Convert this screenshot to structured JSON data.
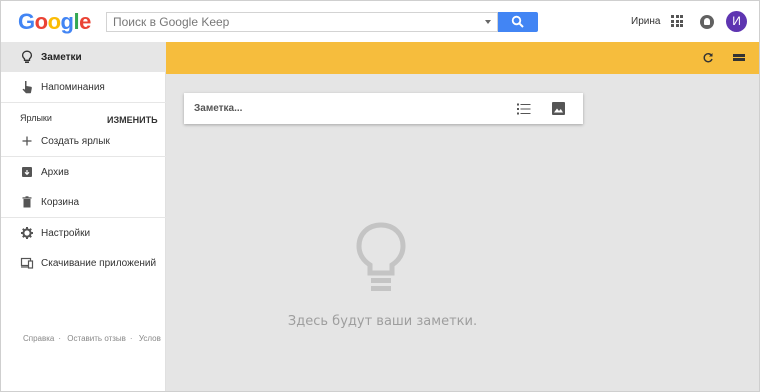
{
  "header": {
    "logo_letters": [
      {
        "ch": "G",
        "color": "#4285f4"
      },
      {
        "ch": "o",
        "color": "#ea4335"
      },
      {
        "ch": "o",
        "color": "#fbbc05"
      },
      {
        "ch": "g",
        "color": "#4285f4"
      },
      {
        "ch": "l",
        "color": "#34a853"
      },
      {
        "ch": "e",
        "color": "#ea4335"
      }
    ],
    "search_placeholder": "Поиск в Google Keep",
    "user_name": "Ирина",
    "avatar_letter": "И",
    "avatar_color": "#5e35b1",
    "search_button_color": "#4285f4"
  },
  "sidebar": {
    "items": [
      {
        "label": "Заметки",
        "icon": "lightbulb-icon",
        "active": true
      },
      {
        "label": "Напоминания",
        "icon": "reminder-hand-icon",
        "active": false
      },
      {
        "label": "Создать ярлык",
        "icon": "plus-icon",
        "active": false
      },
      {
        "label": "Архив",
        "icon": "archive-icon",
        "active": false
      },
      {
        "label": "Корзина",
        "icon": "trash-icon",
        "active": false
      },
      {
        "label": "Настройки",
        "icon": "gear-icon",
        "active": false
      },
      {
        "label": "Скачивание приложений",
        "icon": "devices-icon",
        "active": false
      }
    ],
    "labels_heading": "Ярлыки",
    "labels_edit": "ИЗМЕНИТЬ",
    "footer_links": [
      "Справка",
      "Оставить отзыв",
      "Услов"
    ]
  },
  "main": {
    "accent_color": "#f6bd3d",
    "note_placeholder": "Заметка...",
    "empty_text": "Здесь будут ваши заметки."
  }
}
